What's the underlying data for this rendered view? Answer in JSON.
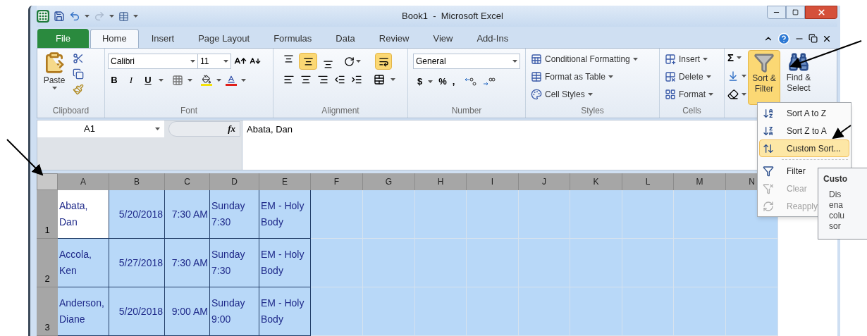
{
  "window": {
    "title": "Book1  -  Microsoft Excel"
  },
  "tabs": [
    {
      "label": "File",
      "kind": "file",
      "selected": false
    },
    {
      "label": "Home",
      "kind": "tab",
      "selected": true
    },
    {
      "label": "Insert",
      "kind": "tab",
      "selected": false
    },
    {
      "label": "Page Layout",
      "kind": "tab",
      "selected": false
    },
    {
      "label": "Formulas",
      "kind": "tab",
      "selected": false
    },
    {
      "label": "Data",
      "kind": "tab",
      "selected": false
    },
    {
      "label": "Review",
      "kind": "tab",
      "selected": false
    },
    {
      "label": "View",
      "kind": "tab",
      "selected": false
    },
    {
      "label": "Add-Ins",
      "kind": "tab",
      "selected": false
    }
  ],
  "clipboard": {
    "paste": "Paste",
    "label": "Clipboard"
  },
  "font": {
    "name": "Calibri",
    "size": "11",
    "styles": [
      "B",
      "I",
      "U"
    ],
    "label": "Font"
  },
  "alignment": {
    "vertical_buttons": [
      {
        "selected": false
      },
      {
        "selected": true
      },
      {
        "selected": false
      }
    ],
    "wrap_text": {
      "on": true
    },
    "label": "Alignment"
  },
  "number": {
    "format": "General",
    "symbols": [
      "$",
      "%",
      ","
    ],
    "label": "Number"
  },
  "styles": {
    "items": [
      "Conditional Formatting",
      "Format as Table",
      "Cell Styles"
    ],
    "label": "Styles"
  },
  "cells": {
    "items": [
      "Insert",
      "Delete",
      "Format"
    ],
    "label": "Cells"
  },
  "editing": {
    "sum": "Σ",
    "sort_filter": {
      "label": "Sort & Filter",
      "on": true
    },
    "find_select": "Find & Select"
  },
  "formula_bar": {
    "name_box": "A1",
    "function_mark": "fx",
    "formula": "Abata, Dan"
  },
  "sheet": {
    "all_selected": true,
    "columns": [
      "A",
      "B",
      "C",
      "D",
      "E",
      "F",
      "G",
      "H",
      "I",
      "J",
      "K",
      "L",
      "M",
      "N"
    ],
    "rows": [
      {
        "number": "1",
        "cells": [
          "Abata, Dan",
          "5/20/2018",
          "7:30 AM",
          "Sunday 7:30",
          "EM - Holy Body"
        ]
      },
      {
        "number": "2",
        "cells": [
          "Accola, Ken",
          "5/27/2018",
          "7:30 AM",
          "Sunday 7:30",
          "EM - Holy Body"
        ]
      },
      {
        "number": "3",
        "cells": [
          "Anderson, Diane",
          "5/20/2018",
          "9:00 AM",
          "Sunday 9:00",
          "EM - Holy Body"
        ]
      }
    ]
  },
  "sort_menu": {
    "sort_items": [
      {
        "label": "Sort A to Z",
        "kind": "az",
        "selected": false,
        "disabled": false
      },
      {
        "label": "Sort Z to A",
        "kind": "za",
        "selected": false,
        "disabled": false
      },
      {
        "label": "Custom Sort...",
        "kind": "custom",
        "selected": true,
        "disabled": false
      }
    ],
    "filter_items": [
      {
        "label": "Filter",
        "kind": "filter",
        "selected": false,
        "disabled": false
      },
      {
        "label": "Clear",
        "kind": "clear",
        "selected": false,
        "disabled": true
      },
      {
        "label": "Reapply",
        "kind": "reapply",
        "selected": false,
        "disabled": true
      }
    ]
  },
  "tooltip": {
    "title": "Custo",
    "lines": [
      "Dis",
      "ena",
      "colu",
      "sor"
    ]
  }
}
